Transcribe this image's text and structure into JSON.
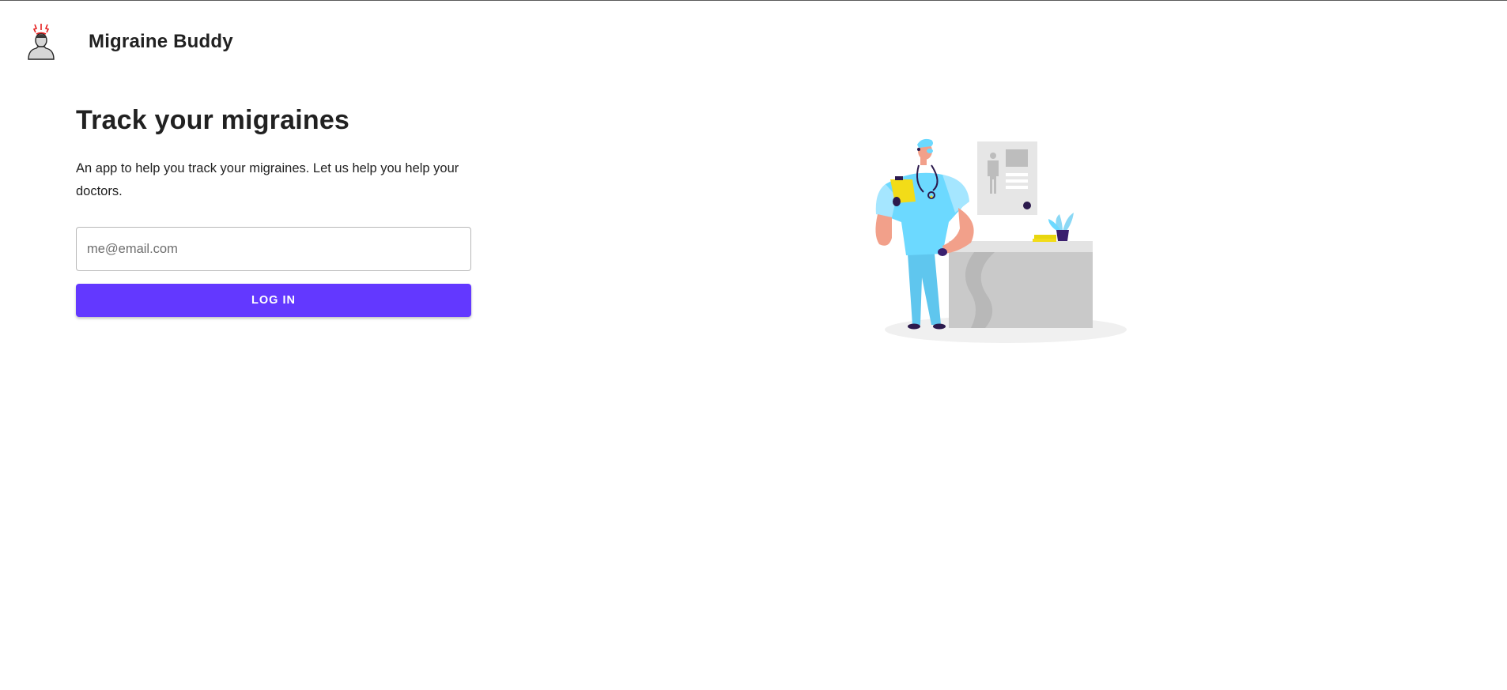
{
  "header": {
    "app_title": "Migraine Buddy",
    "logo_icon": "migraine-head-icon"
  },
  "main": {
    "title": "Track your migraines",
    "description": "An app to help you track your migraines. Let us help you help your doctors.",
    "email_placeholder": "me@email.com",
    "email_value": "",
    "login_label": "LOG IN"
  },
  "illustration": {
    "icon": "doctor-illustration"
  },
  "colors": {
    "accent": "#6338ff",
    "scrubs": "#6cd9ff",
    "clipboard": "#f2dc18"
  }
}
